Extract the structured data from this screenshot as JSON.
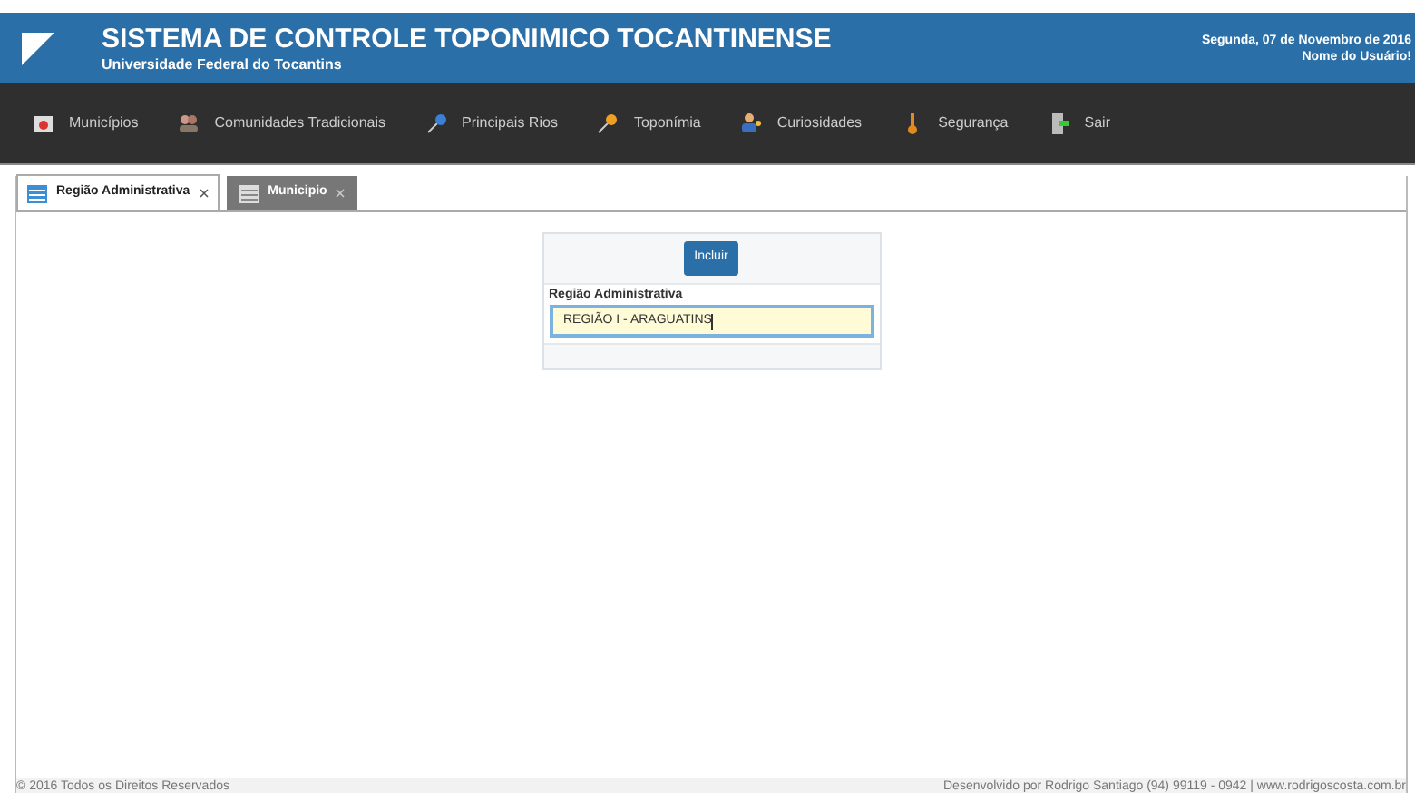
{
  "header": {
    "title": "SISTEMA DE CONTROLE TOPONIMICO TOCANTINENSE",
    "subtitle": "Universidade Federal do Tocantins",
    "date": "Segunda, 07 de Novembro de 2016",
    "user": "Nome do Usuário!"
  },
  "menu": [
    {
      "label": "Municípios"
    },
    {
      "label": "Comunidades Tradicionais"
    },
    {
      "label": "Principais Rios"
    },
    {
      "label": "Toponímia"
    },
    {
      "label": "Curiosidades"
    },
    {
      "label": "Segurança"
    },
    {
      "label": "Sair"
    }
  ],
  "tabs": [
    {
      "label": "Região Administrativa",
      "selected": true
    },
    {
      "label": "Municipio",
      "selected": false
    }
  ],
  "form": {
    "button": "Incluir",
    "field_label": "Região Administrativa",
    "field_value": "REGIÃO I - ARAGUATINS"
  },
  "footer": {
    "left": "© 2016 Todos os Direitos Reservados",
    "right": "Desenvolvido por Rodrigo Santiago (94) 99119 - 0942 | www.rodrigoscosta.com.br"
  }
}
